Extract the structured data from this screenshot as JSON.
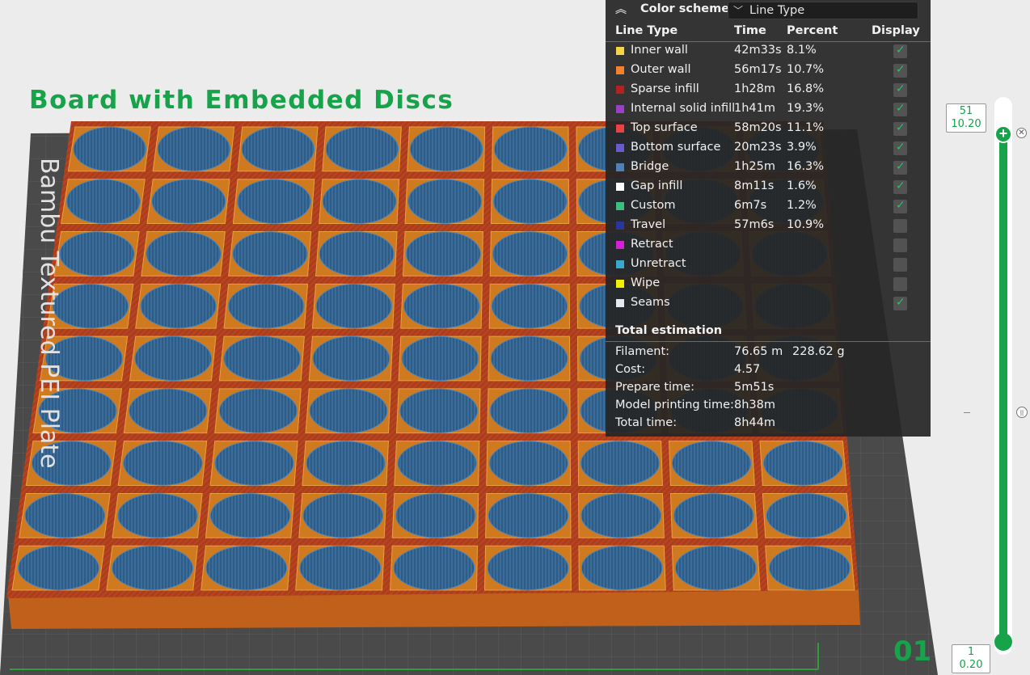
{
  "scene": {
    "model_title": "Board with Embedded Discs",
    "plate_label": "Bambu Textured PEI Plate",
    "plate_number": "01",
    "colors": {
      "model_title": "#16a34a",
      "accent": "#16a34a",
      "wall": "#c0601a",
      "infill": "#9e2a24",
      "disc": "#3a6d9a"
    }
  },
  "legend": {
    "title": "Color scheme",
    "selected_scheme": "Line Type",
    "headers": {
      "type": "Line Type",
      "time": "Time",
      "percent": "Percent",
      "display": "Display"
    },
    "rows": [
      {
        "name": "Inner wall",
        "time": "42m33s",
        "percent": "8.1%",
        "color": "#f6d445",
        "display": true
      },
      {
        "name": "Outer wall",
        "time": "56m17s",
        "percent": "10.7%",
        "color": "#f5822b",
        "display": true
      },
      {
        "name": "Sparse infill",
        "time": "1h28m",
        "percent": "16.8%",
        "color": "#b22222",
        "display": true
      },
      {
        "name": "Internal solid infill",
        "time": "1h41m",
        "percent": "19.3%",
        "color": "#9b3fc7",
        "display": true
      },
      {
        "name": "Top surface",
        "time": "58m20s",
        "percent": "11.1%",
        "color": "#e84242",
        "display": true
      },
      {
        "name": "Bottom surface",
        "time": "20m23s",
        "percent": "3.9%",
        "color": "#6a5acd",
        "display": true
      },
      {
        "name": "Bridge",
        "time": "1h25m",
        "percent": "16.3%",
        "color": "#4f80b8",
        "display": true
      },
      {
        "name": "Gap infill",
        "time": "8m11s",
        "percent": "1.6%",
        "color": "#ffffff",
        "display": true
      },
      {
        "name": "Custom",
        "time": "6m7s",
        "percent": "1.2%",
        "color": "#3fbf7f",
        "display": true
      },
      {
        "name": "Travel",
        "time": "57m6s",
        "percent": "10.9%",
        "color": "#27379b",
        "display": false
      },
      {
        "name": "Retract",
        "time": "",
        "percent": "",
        "color": "#d61fd6",
        "display": false
      },
      {
        "name": "Unretract",
        "time": "",
        "percent": "",
        "color": "#3aa8cc",
        "display": false
      },
      {
        "name": "Wipe",
        "time": "",
        "percent": "",
        "color": "#f2f200",
        "display": false
      },
      {
        "name": "Seams",
        "time": "",
        "percent": "",
        "color": "#e4e9f2",
        "display": true
      }
    ],
    "estimation": {
      "title": "Total estimation",
      "filament_label": "Filament:",
      "filament_length": "76.65 m",
      "filament_weight": "228.62 g",
      "cost_label": "Cost:",
      "cost": "4.57",
      "prepare_label": "Prepare time:",
      "prepare": "5m51s",
      "model_time_label": "Model printing time:",
      "model_time": "8h38m",
      "total_label": "Total time:",
      "total": "8h44m"
    }
  },
  "slider": {
    "top_layer": "51",
    "top_height": "10.20",
    "bottom_layer": "1",
    "bottom_height": "0.20"
  }
}
